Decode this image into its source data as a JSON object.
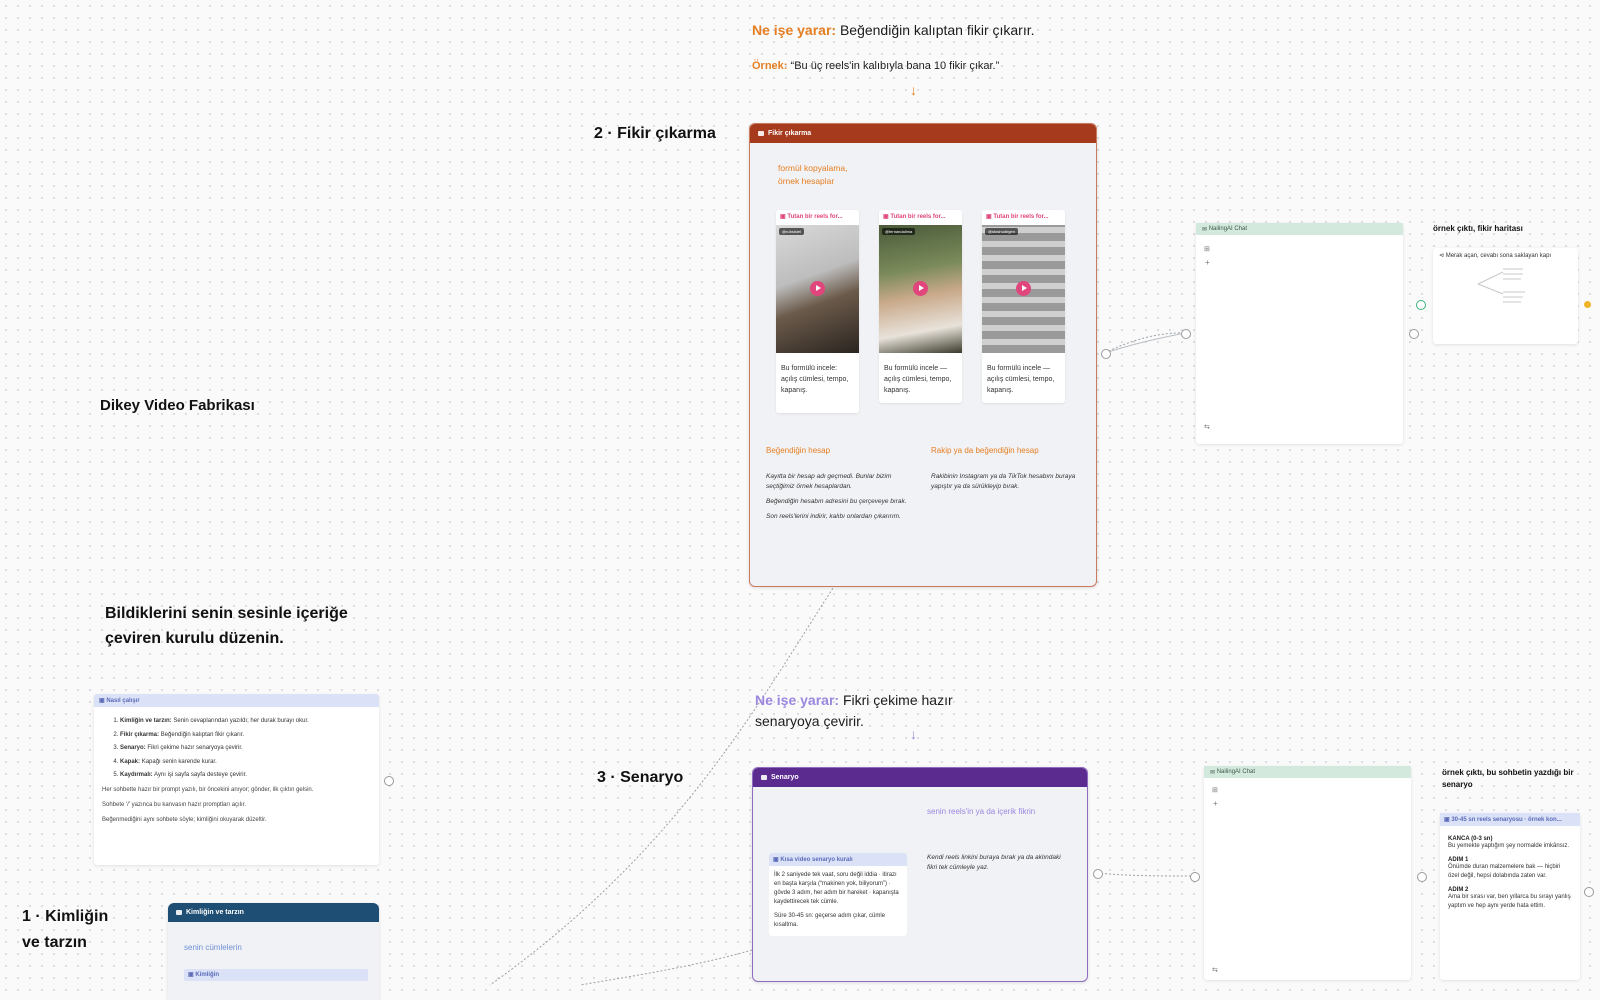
{
  "canvas": {
    "title": "Dikey Video Fabrikası",
    "tagline": "Bildiklerini senin sesinle içeriğe çeviren kurulu düzenin."
  },
  "colors": {
    "fikir_header": "#a63a1d",
    "senaryo_header": "#5c2b8f",
    "kimlik_header": "#1e4e73",
    "accent_orange": "#e67e22",
    "accent_purple": "#9b87e0",
    "chat_header": "#d4e9dd"
  },
  "step2": {
    "label": "2 · Fikir çıkarma",
    "purpose_prefix": "Ne işe yarar:",
    "purpose_text": "Beğendiğin kalıptan fikir çıkarır.",
    "example_prefix": "Örnek:",
    "example_text": "“Bu üç reels'in kalıbıyla bana 10 fikir çıkar.”",
    "card_title": "Fikir çıkarma",
    "subtitle": "formül kopyalama, örnek hesaplar",
    "reels": [
      {
        "header": "Tutan bir reels for...",
        "handle": "@rubsistel",
        "caption": "Bu formülü incele: açılış cümlesi, tempo, kapanış."
      },
      {
        "header": "Tutan bir reels for...",
        "handle": "@fernandalima",
        "caption": "Bu formülü incele — açılış cümlesi, tempo, kapanış."
      },
      {
        "header": "Tutan bir reels for...",
        "handle": "@stoshudirgen",
        "caption": "Bu formülü incele — açılış cümlesi, tempo, kapanış."
      }
    ],
    "left_col_title": "Beğendiğin hesap",
    "left_col_lines": [
      "Kayıtta bir hesap adı geçmedi. Bunlar bizim seçtiğimiz örnek hesaplardan.",
      "Beğendiğin hesabın adresini bu çerçeveye bırak.",
      "Son reels'lerini indirir, kalıbı onlardan çıkarırım."
    ],
    "right_col_title": "Rakip ya da beğendiğin hesap",
    "right_col_text": "Rakibinin Instagram ya da TikTok hesabını buraya yapıştır ya da sürükleyip bırak.",
    "chat_title": "NailingAI Chat",
    "output_label": "örnek çıktı, fikir haritası",
    "output_card_title": "Merak açan, cevabı sona saklayan kapı"
  },
  "step3": {
    "label": "3 · Senaryo",
    "purpose_prefix": "Ne işe yarar:",
    "purpose_text": "Fikri çekime hazır senaryoya çevirir.",
    "card_title": "Senaryo",
    "subtitle": "senin reels'in ya da içerik fikrin",
    "inner_title": "Kısa video senaryo kuralı",
    "inner_text_1": "İlk 2 saniyede tek vaat, soru değil iddia · itirazı en başta karşıla (“makinen yok, biliyorum”) · gövde 3 adım, her adım bir hareket · kapanışta kaydettirecek tek cümle.",
    "inner_text_2": "Süre 30-45 sn: geçerse adım çıkar, cümle kısaltma.",
    "right_text": "Kendi reels linkini buraya bırak ya da aklındaki fikri tek cümleyle yaz.",
    "chat_title": "NailingAI Chat",
    "output_label": "örnek çıktı, bu sohbetin yazdığı bir senaryo",
    "output_card_title": "30-45 sn reels senaryosu · örnek kon...",
    "output_sections": [
      {
        "head": "KANCA (0-3 sn)",
        "text": "Bu yemekte yaptığım şey normalde imkânsız."
      },
      {
        "head": "ADIM 1",
        "text": "Önümde duran malzemelere bak — hiçbiri özel değil, hepsi dolabında zaten var."
      },
      {
        "head": "ADIM 2",
        "text": "Ama bir sırası var, ben yıllarca bu sırayı yanlış yaptım ve hep aynı yerde hata ettim."
      }
    ]
  },
  "how": {
    "title": "Nasıl çalışır",
    "steps": [
      {
        "bold": "Kimliğin ve tarzın:",
        "text": "Senin cevaplarından yazıldı; her durak burayı okur."
      },
      {
        "bold": "Fikir çıkarma:",
        "text": "Beğendiğin kalıptan fikir çıkarır."
      },
      {
        "bold": "Senaryo:",
        "text": "Fikri çekime hazır senaryoya çevirir."
      },
      {
        "bold": "Kapak:",
        "text": "Kapağı senin karende kurar."
      },
      {
        "bold": "Kaydırmalı:",
        "text": "Aynı işi sayfa sayfa desteye çevirir."
      }
    ],
    "note1": "Her sohbette hazır bir prompt yazılı, bir öncekini anıyor; gönder, ilk çıktın gelsin.",
    "note2": "Sohbete '/' yazınca bu kanvasın hazır promptları açılır.",
    "note3": "Beğenmediğini aynı sohbete söyle; kimliğini okuyarak düzeltir."
  },
  "step1": {
    "label_line1": "1 · Kimliğin",
    "label_line2": "ve tarzın",
    "card_title": "Kimliğin ve tarzın",
    "subtitle": "senin cümlelerin",
    "inner_title": "Kimliğin"
  }
}
